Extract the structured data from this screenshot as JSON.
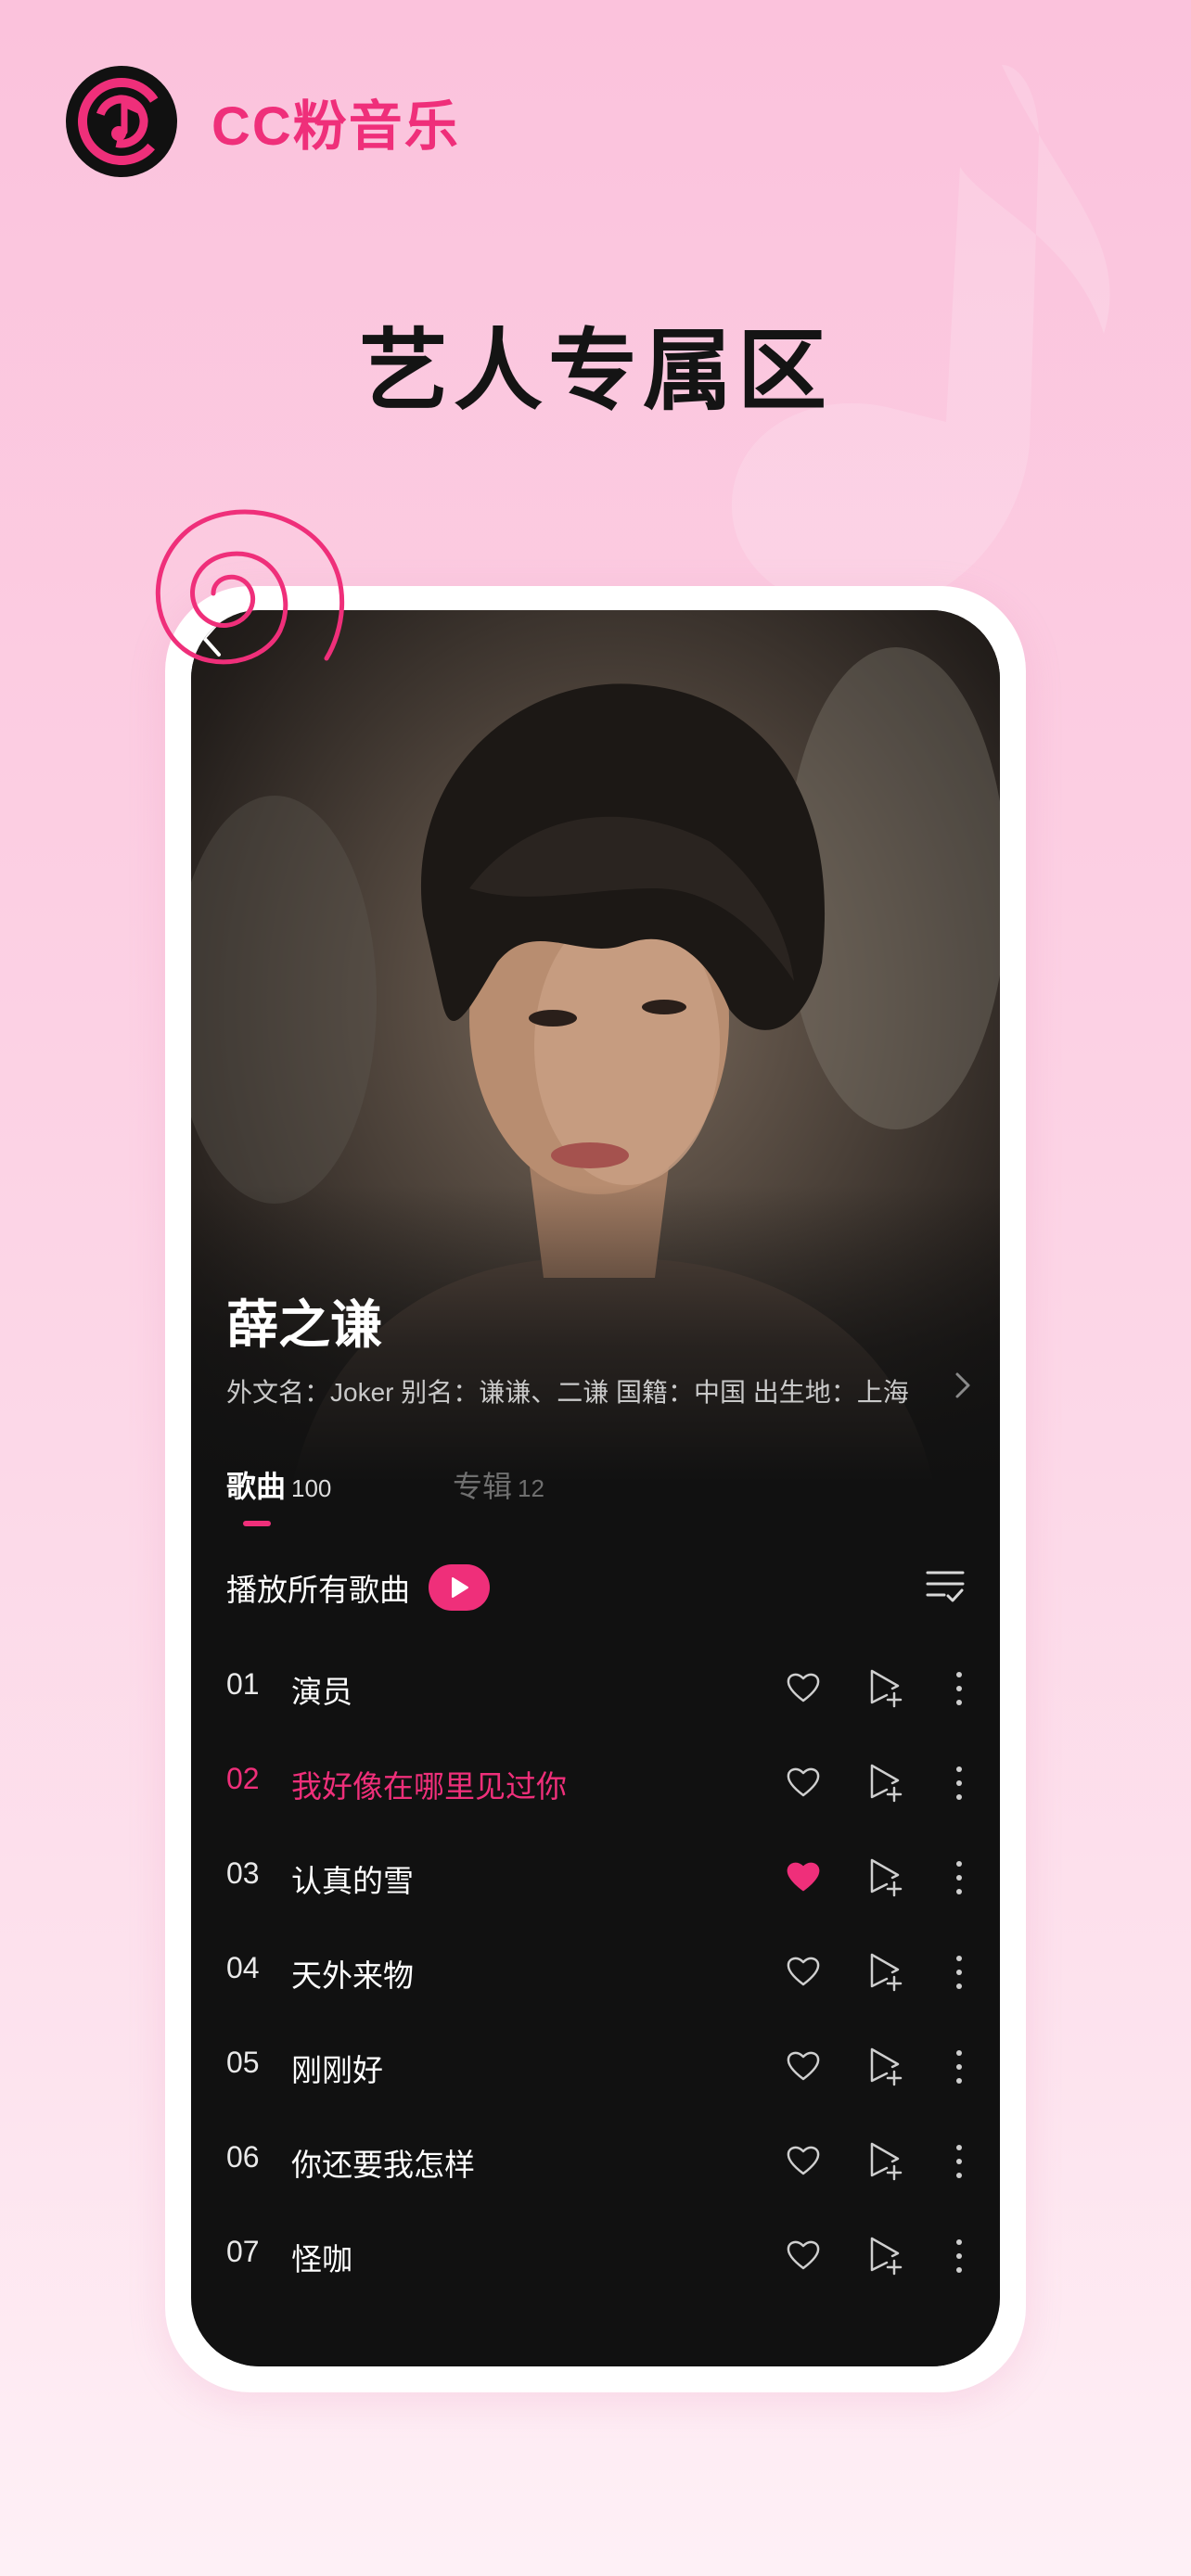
{
  "brand": {
    "name": "CC粉音乐",
    "logo_icon": "music-note-disc-logo"
  },
  "headline": "艺人专属区",
  "colors": {
    "accent": "#ef2f7a",
    "background_top": "#fbc2dc",
    "background_bottom": "#fef0f6",
    "screen_bg": "#111111"
  },
  "artist": {
    "name": "薛之谦",
    "meta": "外文名：Joker 别名：谦谦、二谦 国籍：中国 出生地：上海"
  },
  "tabs": [
    {
      "label": "歌曲",
      "count": "100",
      "active": true
    },
    {
      "label": "专辑",
      "count": "12",
      "active": false
    }
  ],
  "play_all": {
    "label": "播放所有歌曲"
  },
  "songs": [
    {
      "num": "01",
      "title": "演员",
      "liked": false,
      "playing": false
    },
    {
      "num": "02",
      "title": "我好像在哪里见过你",
      "liked": false,
      "playing": true
    },
    {
      "num": "03",
      "title": "认真的雪",
      "liked": true,
      "playing": false
    },
    {
      "num": "04",
      "title": "天外来物",
      "liked": false,
      "playing": false
    },
    {
      "num": "05",
      "title": "刚刚好",
      "liked": false,
      "playing": false
    },
    {
      "num": "06",
      "title": "你还要我怎样",
      "liked": false,
      "playing": false
    },
    {
      "num": "07",
      "title": "怪咖",
      "liked": false,
      "playing": false
    }
  ]
}
